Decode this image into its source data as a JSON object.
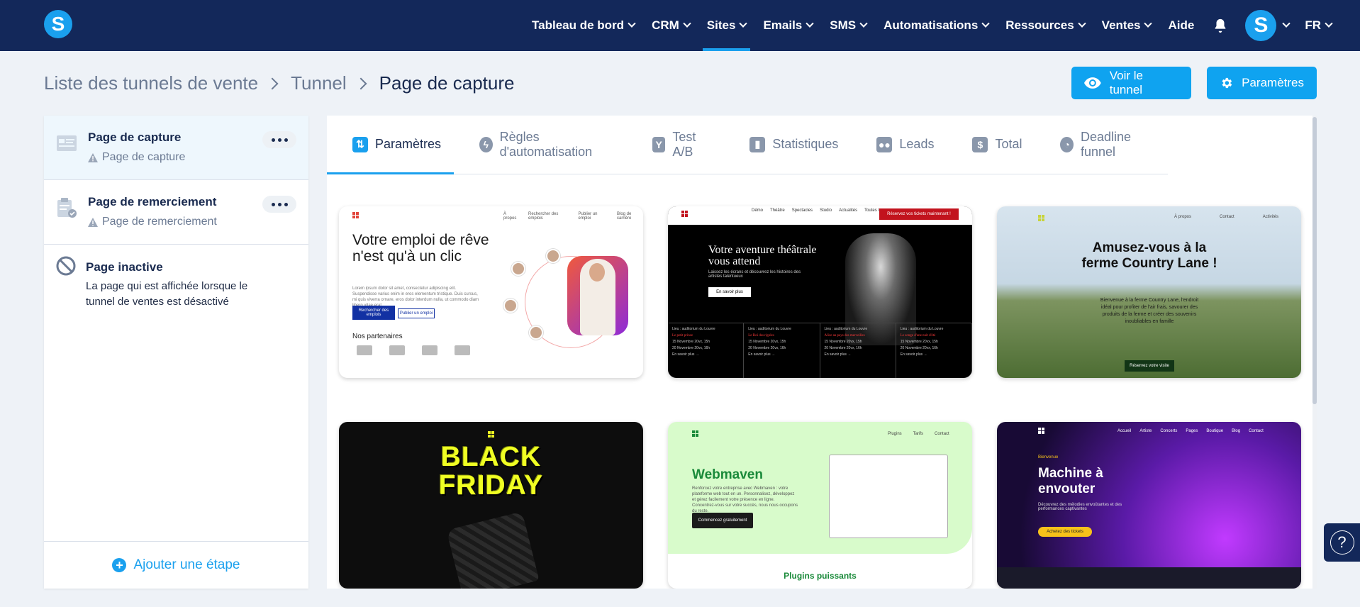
{
  "app": {
    "logo_letter": "S",
    "colors": {
      "topbar": "#13285a",
      "accent": "#1aa0ee",
      "primary_button": "#0fa3f0"
    }
  },
  "nav": {
    "items": [
      {
        "label": "Tableau de bord",
        "dropdown": true,
        "active": false
      },
      {
        "label": "CRM",
        "dropdown": true,
        "active": false
      },
      {
        "label": "Sites",
        "dropdown": true,
        "active": true
      },
      {
        "label": "Emails",
        "dropdown": true,
        "active": false
      },
      {
        "label": "SMS",
        "dropdown": true,
        "active": false
      },
      {
        "label": "Automatisations",
        "dropdown": true,
        "active": false
      },
      {
        "label": "Ressources",
        "dropdown": true,
        "active": false
      },
      {
        "label": "Ventes",
        "dropdown": true,
        "active": false
      },
      {
        "label": "Aide",
        "dropdown": false,
        "active": false
      }
    ],
    "bell_icon": "bell-icon",
    "avatar_letter": "S",
    "language": "FR"
  },
  "breadcrumb": {
    "items": [
      "Liste des tunnels de vente",
      "Tunnel",
      "Page de capture"
    ]
  },
  "actions": {
    "view_label": "Voir le tunnel",
    "settings_label": "Paramètres"
  },
  "sidebar": {
    "steps": [
      {
        "title": "Page de capture",
        "subtitle": "Page de capture",
        "active": true
      },
      {
        "title": "Page de remerciement",
        "subtitle": "Page de remerciement",
        "active": false
      }
    ],
    "inactive": {
      "title": "Page inactive",
      "description": "La page qui est affichée lorsque le tunnel de ventes est désactivé"
    },
    "add_step_label": "Ajouter une étape"
  },
  "tabs": [
    {
      "label": "Paramètres",
      "icon": "sliders-icon",
      "active": true
    },
    {
      "label": "Règles d'automatisation",
      "icon": "bolt-icon",
      "active": false
    },
    {
      "label": "Test A/B",
      "icon": "split-icon",
      "active": false
    },
    {
      "label": "Statistiques",
      "icon": "chart-icon",
      "active": false
    },
    {
      "label": "Leads",
      "icon": "users-icon",
      "active": false
    },
    {
      "label": "Total",
      "icon": "dollar-icon",
      "active": false
    },
    {
      "label": "Deadline funnel",
      "icon": "clock-icon",
      "active": false
    }
  ],
  "templates": {
    "t1": {
      "nav": [
        "À propos",
        "Rechercher des emplois",
        "Publier un emploi",
        "Blog de carrière"
      ],
      "headline": "Votre emploi de rêve n'est qu'à un clic",
      "body": "Lorem ipsum dolor sit amet, consectetur adipiscing elit. Suspendisse varius enim in eros elementum tristique. Duis cursus, mi quis viverra ornare, eros dolor interdum nulla, ut commodo diam libero vitae erat.",
      "btn1": "Rechercher des emplois",
      "btn2": "Publier un emploi",
      "partners": "Nos partenaires"
    },
    "t2": {
      "nav": [
        "Démo",
        "Théâtre",
        "Spectacles",
        "Studio",
        "Actualités",
        "Toutes les pages"
      ],
      "cta": "Réservez vos tickets maintenant !",
      "headline": "Votre aventure théâtrale vous attend",
      "body": "Laissez les écrans et découvrez les histoires des artistes talentueux",
      "btn": "En savoir plus",
      "events": [
        {
          "place": "Lieu : auditorium du Louvre",
          "title": "Le petit prince",
          "date1": "15 Novembre 20vx, 15h",
          "date2": "20 Novembre 20vx, 16h",
          "link": "En savoir plus →"
        },
        {
          "place": "Lieu : auditorium du Louvre",
          "title": "Le Roi des rigoles",
          "date1": "15 Novembre 20vx, 15h",
          "date2": "20 Novembre 20vx, 16h",
          "link": "En savoir plus →"
        },
        {
          "place": "Lieu : auditorium du Louvre",
          "title": "Alice au pays des merveilles",
          "date1": "15 Novembre 20vx, 15h",
          "date2": "20 Novembre 20vx, 16h",
          "link": "En savoir plus →"
        },
        {
          "place": "Lieu : auditorium du Louvre",
          "title": "Le songe d'une nuit d'été",
          "date1": "15 Novembre 20vx, 15h",
          "date2": "20 Novembre 20vx, 16h",
          "link": "En savoir plus →"
        }
      ]
    },
    "t3": {
      "nav": [
        "À propos",
        "Contact",
        "Activités"
      ],
      "headline": "Amusez-vous à la ferme Country Lane !",
      "body": "Bienvenue à la ferme Country Lane, l'endroit idéal pour profiter de l'air frais, savourer des produits de la ferme et créer des souvenirs inoubliables en famille",
      "btn": "Réservez votre visite"
    },
    "t4": {
      "line1": "BLACK",
      "line2": "FRIDAY"
    },
    "t5": {
      "nav": [
        "Plugins",
        "Tarifs",
        "Contact"
      ],
      "headline": "Webmaven",
      "body": "Renforcez votre entreprise avec Webmaven : votre plateforme web tout en un. Personnalisez, développez et gérez facilement votre présence en ligne. Concentrez-vous sur votre succès, nous nous occupons du reste.",
      "btn": "Commencez gratuitement",
      "section": "Plugins puissants"
    },
    "t6": {
      "nav": [
        "Accueil",
        "Artiste",
        "Concerts",
        "Pages",
        "Boutique",
        "Blog",
        "Contact"
      ],
      "kicker": "Bienvenue",
      "headline": "Machine à envouter",
      "body": "Découvrez des mélodies envoûtantes et des performances captivantes",
      "btn": "Achetez des tickets"
    }
  },
  "help": {
    "icon": "help-icon",
    "glyph": "?"
  }
}
